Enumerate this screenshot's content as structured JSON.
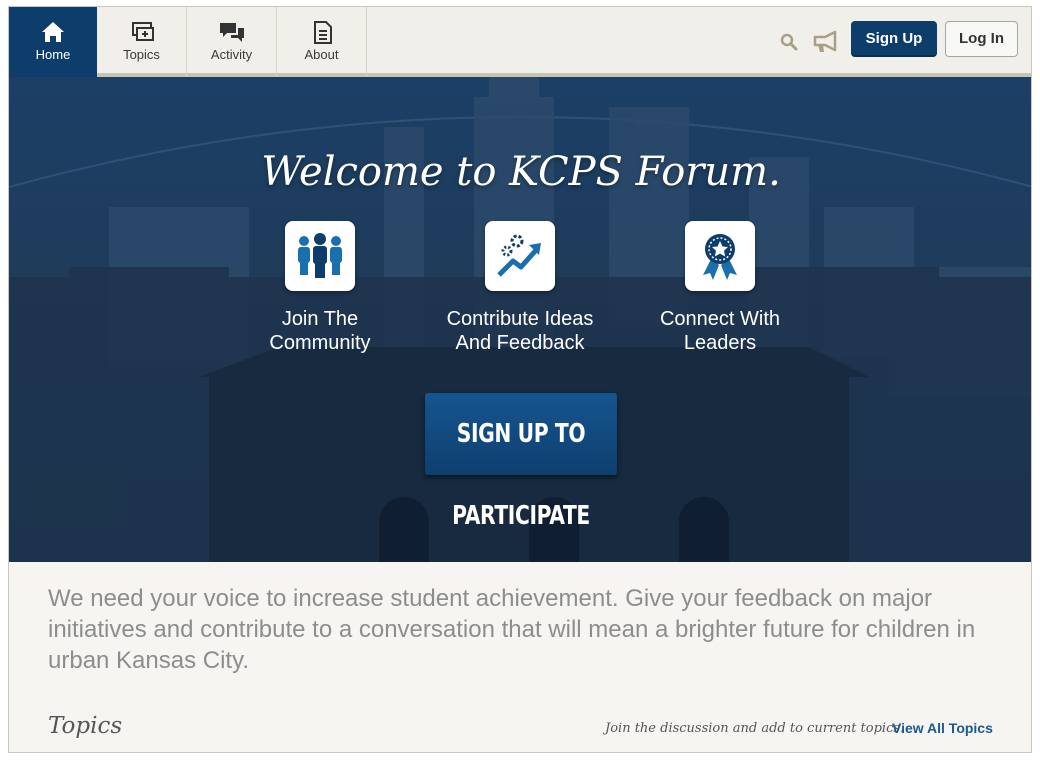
{
  "nav": {
    "tabs": [
      {
        "label": "Home",
        "icon": "home-icon",
        "active": true
      },
      {
        "label": "Topics",
        "icon": "topics-icon",
        "active": false
      },
      {
        "label": "Activity",
        "icon": "activity-icon",
        "active": false
      },
      {
        "label": "About",
        "icon": "about-icon",
        "active": false
      }
    ],
    "search_icon": "search-icon",
    "announce_icon": "megaphone-icon",
    "signup_label": "Sign Up",
    "login_label": "Log In"
  },
  "hero": {
    "title": "Welcome to KCPS Forum.",
    "features": [
      {
        "label_line1": "Join The",
        "label_line2": "Community",
        "icon": "people-icon"
      },
      {
        "label_line1": "Contribute Ideas",
        "label_line2": "And Feedback",
        "icon": "ideas-growth-icon"
      },
      {
        "label_line1": "Connect With",
        "label_line2": "Leaders",
        "icon": "award-ribbon-icon"
      }
    ],
    "cta_label": "SIGN UP TO PARTICIPATE"
  },
  "intro_text": "We need your voice to increase student achievement. Give your feedback on major initiatives and contribute to a conversation that will mean a brighter future for children in urban Kansas City.",
  "topics": {
    "heading": "Topics",
    "note": "Join the discussion and add to current topics.",
    "view_all_label": "View All Topics"
  },
  "colors": {
    "brand_navy": "#0d3d6b",
    "hero_blue": "#1f3c5b",
    "link_blue": "#1a5a8f",
    "accent_tan": "#c9c3b4"
  }
}
